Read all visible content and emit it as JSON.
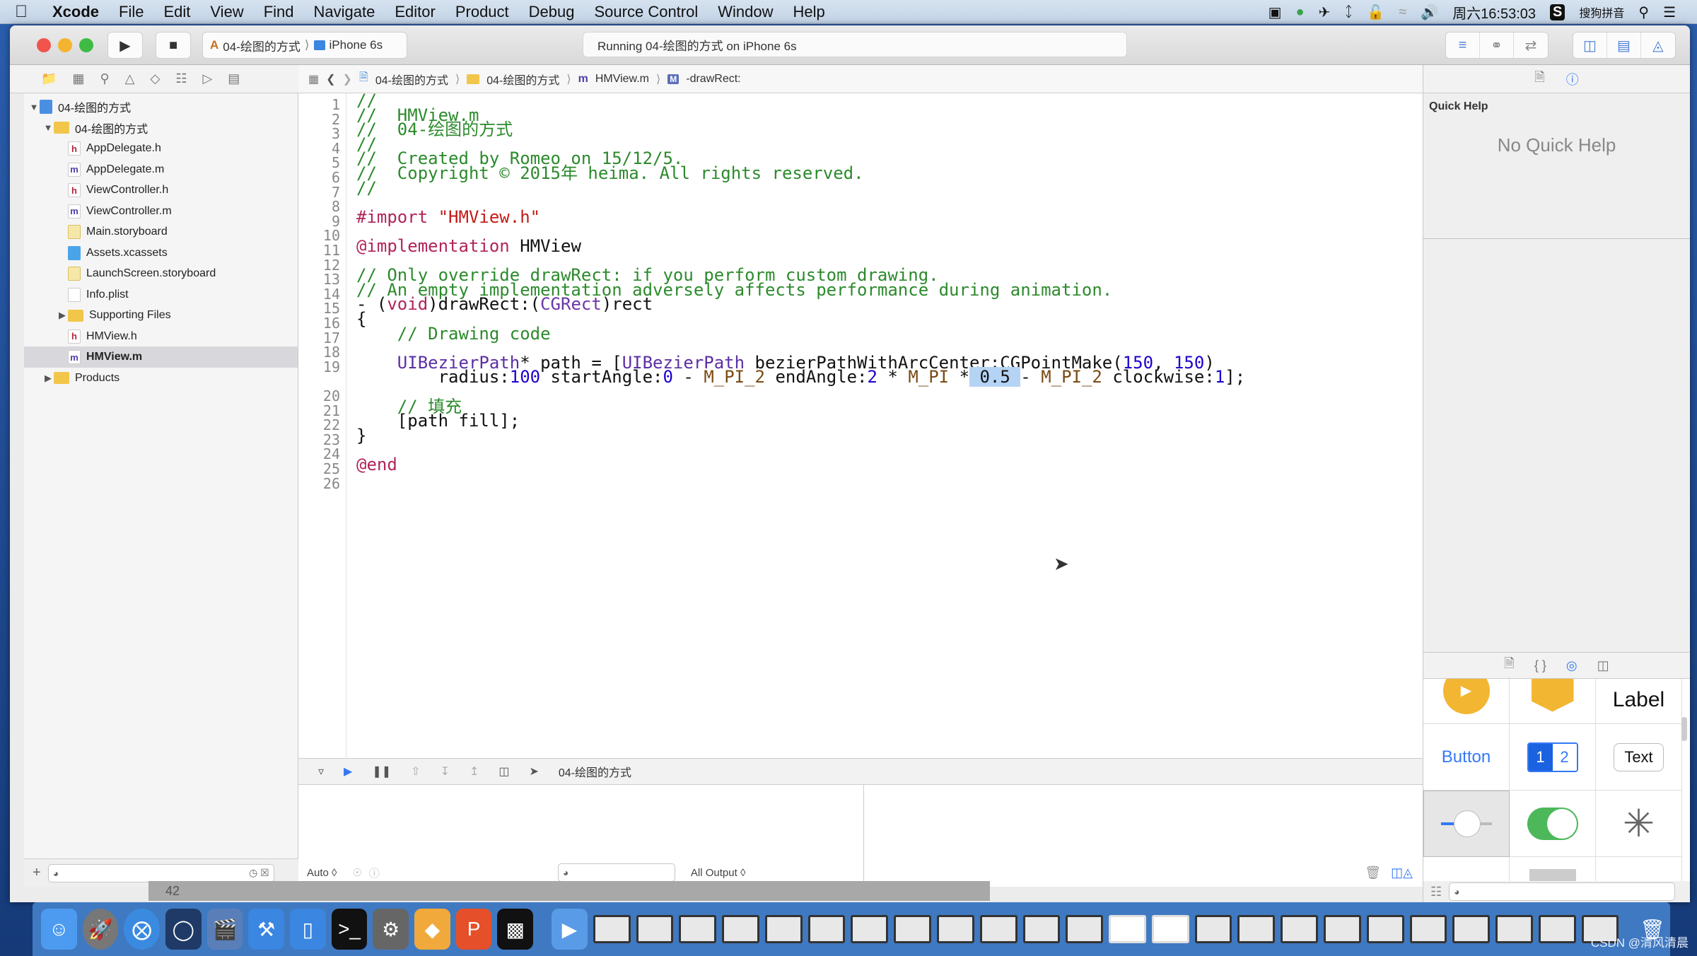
{
  "menubar": {
    "app": "Xcode",
    "items": [
      "File",
      "Edit",
      "View",
      "Find",
      "Navigate",
      "Editor",
      "Product",
      "Debug",
      "Source Control",
      "Window",
      "Help"
    ],
    "clock": "周六16:53:03",
    "input_method": "搜狗拼音"
  },
  "toolbar": {
    "scheme": "04-绘图的方式",
    "device": "iPhone 6s",
    "activity": "Running 04-绘图的方式 on iPhone 6s"
  },
  "navigator": {
    "items": [
      {
        "label": "04-绘图的方式",
        "type": "proj",
        "level": 0,
        "disclosure": "▼"
      },
      {
        "label": "04-绘图的方式",
        "type": "folder",
        "level": 1,
        "disclosure": "▼"
      },
      {
        "label": "AppDelegate.h",
        "type": "h",
        "level": 2
      },
      {
        "label": "AppDelegate.m",
        "type": "m",
        "level": 2
      },
      {
        "label": "ViewController.h",
        "type": "h",
        "level": 2
      },
      {
        "label": "ViewController.m",
        "type": "m",
        "level": 2
      },
      {
        "label": "Main.storyboard",
        "type": "sb",
        "level": 2
      },
      {
        "label": "Assets.xcassets",
        "type": "assets",
        "level": 2
      },
      {
        "label": "LaunchScreen.storyboard",
        "type": "sb",
        "level": 2
      },
      {
        "label": "Info.plist",
        "type": "plist",
        "level": 2
      },
      {
        "label": "Supporting Files",
        "type": "folder",
        "level": 2,
        "disclosure": "▶"
      },
      {
        "label": "HMView.h",
        "type": "h",
        "level": 2
      },
      {
        "label": "HMView.m",
        "type": "m",
        "level": 2,
        "selected": true
      },
      {
        "label": "Products",
        "type": "folder",
        "level": 1,
        "disclosure": "▶"
      }
    ]
  },
  "jumpbar": {
    "crumbs": [
      "04-绘图的方式",
      "04-绘图的方式",
      "HMView.m",
      "-drawRect:"
    ]
  },
  "editor": {
    "lines": [
      [
        {
          "t": "//",
          "c": "com"
        }
      ],
      [
        {
          "t": "//  HMView.m",
          "c": "com"
        }
      ],
      [
        {
          "t": "//  04-绘图的方式",
          "c": "com"
        }
      ],
      [
        {
          "t": "//",
          "c": "com"
        }
      ],
      [
        {
          "t": "//  Created by Romeo on 15/12/5.",
          "c": "com"
        }
      ],
      [
        {
          "t": "//  Copyright © 2015年 heima. All rights reserved.",
          "c": "com"
        }
      ],
      [
        {
          "t": "//",
          "c": "com"
        }
      ],
      [],
      [
        {
          "t": "#import ",
          "c": "kw"
        },
        {
          "t": "\"HMView.h\"",
          "c": "str"
        }
      ],
      [],
      [
        {
          "t": "@implementation",
          "c": "kw"
        },
        {
          "t": " HMView",
          "c": ""
        }
      ],
      [],
      [
        {
          "t": "// Only override drawRect: if you perform custom drawing.",
          "c": "com"
        }
      ],
      [
        {
          "t": "// An empty implementation adversely affects performance during animation.",
          "c": "com"
        }
      ],
      [
        {
          "t": "- (",
          "c": ""
        },
        {
          "t": "void",
          "c": "kw"
        },
        {
          "t": ")drawRect:(",
          "c": ""
        },
        {
          "t": "CGRect",
          "c": "type"
        },
        {
          "t": ")rect",
          "c": ""
        }
      ],
      [
        {
          "t": "{",
          "c": ""
        }
      ],
      [
        {
          "t": "    // Drawing code",
          "c": "com"
        }
      ],
      [],
      [
        {
          "t": "    ",
          "c": ""
        },
        {
          "t": "UIBezierPath",
          "c": "cls"
        },
        {
          "t": "* path = [",
          "c": ""
        },
        {
          "t": "UIBezierPath",
          "c": "cls"
        },
        {
          "t": " bezierPathWithArcCenter:CGPointMake(",
          "c": ""
        },
        {
          "t": "150",
          "c": "num"
        },
        {
          "t": ", ",
          "c": ""
        },
        {
          "t": "150",
          "c": "num"
        },
        {
          "t": ")",
          "c": ""
        }
      ],
      [
        {
          "t": "        radius:",
          "c": ""
        },
        {
          "t": "100",
          "c": "num"
        },
        {
          "t": " startAngle:",
          "c": ""
        },
        {
          "t": "0",
          "c": "num"
        },
        {
          "t": " - ",
          "c": ""
        },
        {
          "t": "M_PI_2",
          "c": "mac"
        },
        {
          "t": " endAngle:",
          "c": ""
        },
        {
          "t": "2",
          "c": "num"
        },
        {
          "t": " * ",
          "c": ""
        },
        {
          "t": "M_PI",
          "c": "mac"
        },
        {
          "t": " *",
          "c": ""
        },
        {
          "t": " 0.5 ",
          "c": "sel"
        },
        {
          "t": "- ",
          "c": ""
        },
        {
          "t": "M_PI_2",
          "c": "mac"
        },
        {
          "t": " clockwise:",
          "c": ""
        },
        {
          "t": "1",
          "c": "num"
        },
        {
          "t": "];",
          "c": ""
        }
      ],
      [],
      [
        {
          "t": "    // 填充",
          "c": "com"
        }
      ],
      [
        {
          "t": "    [path fill];",
          "c": ""
        }
      ],
      [
        {
          "t": "}",
          "c": ""
        }
      ],
      [],
      [
        {
          "t": "@end",
          "c": "kw"
        }
      ],
      []
    ],
    "line_numbers": [
      "1",
      "2",
      "3",
      "4",
      "5",
      "6",
      "7",
      "8",
      "9",
      "10",
      "11",
      "12",
      "13",
      "14",
      "15",
      "16",
      "17",
      "18",
      "19",
      "",
      "20",
      "21",
      "22",
      "23",
      "24",
      "25",
      "26"
    ]
  },
  "debug": {
    "process": "04-绘图的方式",
    "var_mode": "Auto ◊",
    "console_mode": "All Output ◊"
  },
  "inspector": {
    "quick_help_title": "Quick Help",
    "quick_help_empty": "No Quick Help"
  },
  "library": {
    "label_item": "Label",
    "button_item": "Button",
    "segment_1": "1",
    "segment_2": "2",
    "text_item": "Text"
  },
  "dock": {
    "space_number": "42",
    "watermark": "CSDN @清风清晨"
  }
}
